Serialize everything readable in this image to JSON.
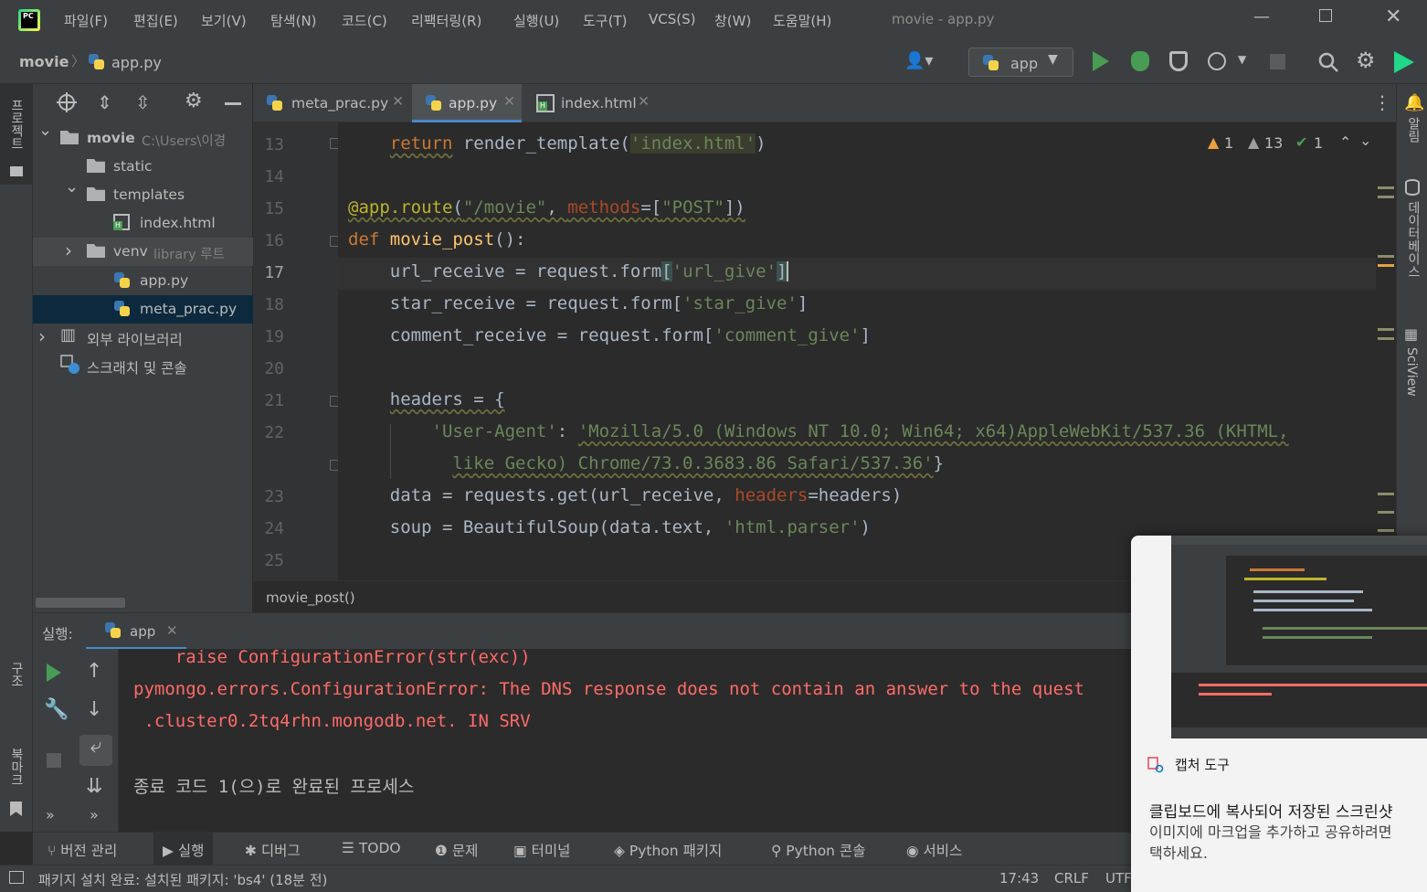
{
  "app": {
    "window_title": "movie - app.py",
    "menu": [
      "파일(F)",
      "편집(E)",
      "보기(V)",
      "탐색(N)",
      "코드(C)",
      "리팩터링(R)",
      "실행(U)",
      "도구(T)",
      "VCS(S)",
      "창(W)",
      "도움말(H)"
    ]
  },
  "nav": {
    "project": "movie",
    "file": "app.py",
    "run_config": "app"
  },
  "left_strip": {
    "project_label": "프로젝트",
    "structure_label": "구조",
    "bookmark_label": "북마크"
  },
  "project_tree": [
    {
      "label": "movie",
      "hint": "C:\\Users\\이경",
      "indent": 0,
      "arrow": "⌄",
      "icon": "folder"
    },
    {
      "label": "static",
      "hint": "",
      "indent": 1,
      "arrow": "",
      "icon": "folder"
    },
    {
      "label": "templates",
      "hint": "",
      "indent": 1,
      "arrow": "⌄",
      "icon": "folder"
    },
    {
      "label": "index.html",
      "hint": "",
      "indent": 2,
      "arrow": "",
      "icon": "html"
    },
    {
      "label": "venv",
      "hint": "library 루트",
      "indent": 1,
      "arrow": "›",
      "icon": "folder"
    },
    {
      "label": "app.py",
      "hint": "",
      "indent": 2,
      "arrow": "",
      "icon": "py"
    },
    {
      "label": "meta_prac.py",
      "hint": "",
      "indent": 2,
      "arrow": "",
      "icon": "py"
    },
    {
      "label": "외부 라이브러리",
      "hint": "",
      "indent": 0,
      "arrow": "›",
      "icon": "lib"
    },
    {
      "label": "스크래치 및 콘솔",
      "hint": "",
      "indent": 0,
      "arrow": "",
      "icon": "scratch"
    }
  ],
  "tabs": [
    {
      "label": "meta_prac.py",
      "active": false
    },
    {
      "label": "app.py",
      "active": true
    },
    {
      "label": "index.html",
      "active": false
    }
  ],
  "inspections": {
    "warn1": "1",
    "warn2": "13",
    "ok": "1"
  },
  "line_numbers": [
    "13",
    "14",
    "15",
    "16",
    "17",
    "18",
    "19",
    "20",
    "21",
    "22",
    "",
    "23",
    "24",
    "25"
  ],
  "breadcrumb": "movie_post()",
  "right_strip": {
    "notifications": "알림",
    "database": "데이터베이스",
    "sciview": "SciView"
  },
  "run": {
    "label": "실행:",
    "config": "app",
    "console": [
      "    raise ConfigurationError(str(exc))",
      "pymongo.errors.ConfigurationError: The DNS response does not contain an answer to the quest",
      " .cluster0.2tq4rhn.mongodb.net. IN SRV",
      "",
      "종료 코드 1(으)로 완료된 프로세스"
    ]
  },
  "bottom_tools": [
    "버전 관리",
    "실행",
    "디버그",
    "TODO",
    "문제",
    "터미널",
    "Python 패키지",
    "Python 콘솔",
    "서비스"
  ],
  "status": {
    "message": "패키지 설치 완료: 설치된 패키지: 'bs4' (18분 전)",
    "time": "17:43",
    "line_sep": "CRLF",
    "encoding": "UTF"
  },
  "notification": {
    "app_name": "캡처 도구",
    "title": "클립보드에 복사되어 저장된 스크린샷",
    "body_1": "이미지에 마크업을 추가하고 공유하려면",
    "body_2": "택하세요."
  },
  "colors": {
    "bg": "#2b2b2b",
    "panel": "#3c3f41",
    "keyword": "#cc7832",
    "string": "#6a8759",
    "decorator": "#bbb529",
    "error": "#ff6b68",
    "run_green": "#499c54"
  }
}
